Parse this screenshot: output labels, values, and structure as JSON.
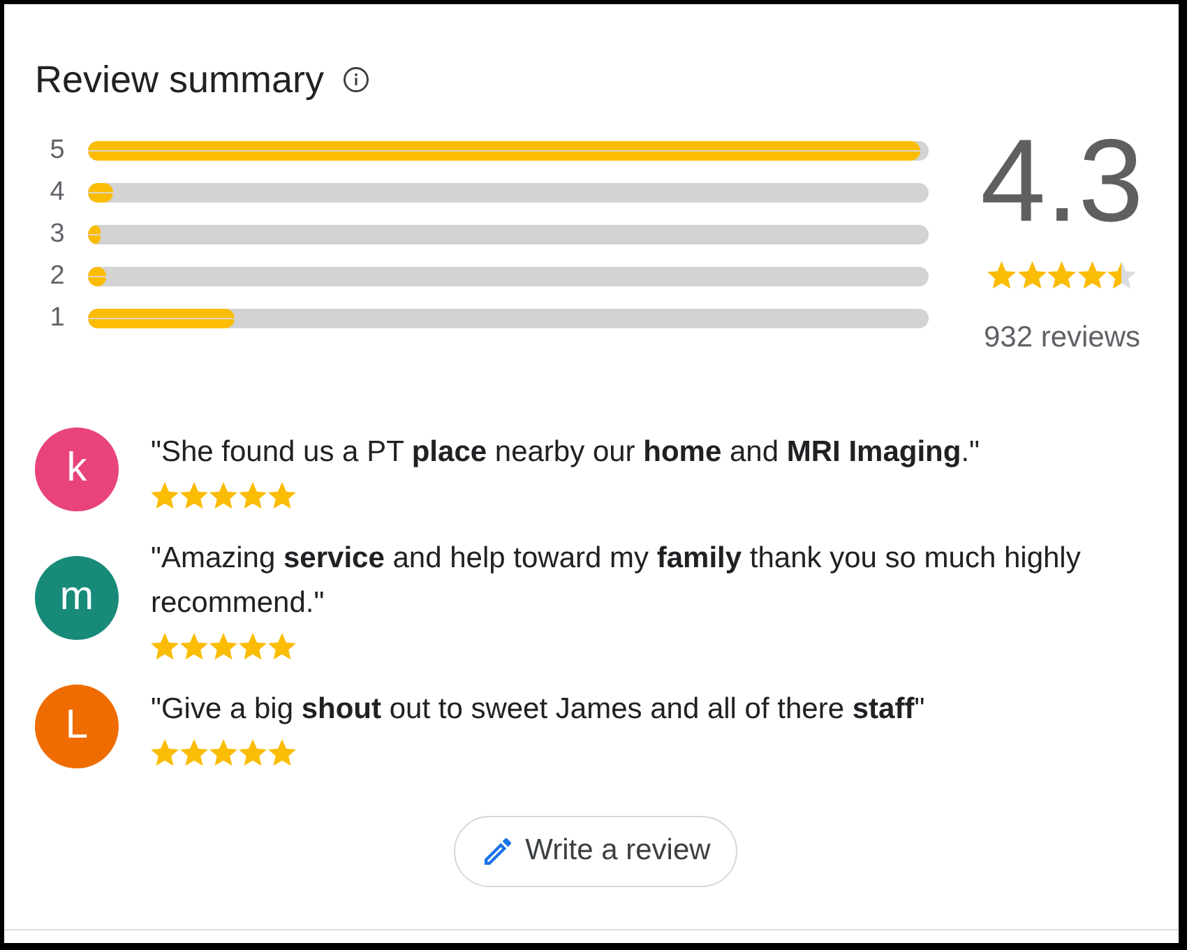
{
  "title": "Review summary",
  "distribution": [
    {
      "label": "5",
      "level": 0.99
    },
    {
      "label": "4",
      "level": 0.03
    },
    {
      "label": "3",
      "level": 0.015
    },
    {
      "label": "2",
      "level": 0.022
    },
    {
      "label": "1",
      "level": 0.175
    }
  ],
  "rating": {
    "value": "4.3",
    "stars": 4.5,
    "count": "932 reviews"
  },
  "reviews": [
    {
      "avatar_letter": "k",
      "color": "#e8437a",
      "text": "\"She found us a PT **place** nearby our **home** and **MRI Imaging**.\"",
      "stars": 5
    },
    {
      "avatar_letter": "m",
      "color": "#178a78",
      "text": "\"Amazing **service** and help toward my **family** thank you so much highly recommend.\"",
      "stars": 5
    },
    {
      "avatar_letter": "L",
      "color": "#ef6c00",
      "text": "\"Give a big **shout** out to sweet James and all of there **staff**\"",
      "stars": 5
    }
  ],
  "write_review_button": {
    "label": "Write a review"
  }
}
